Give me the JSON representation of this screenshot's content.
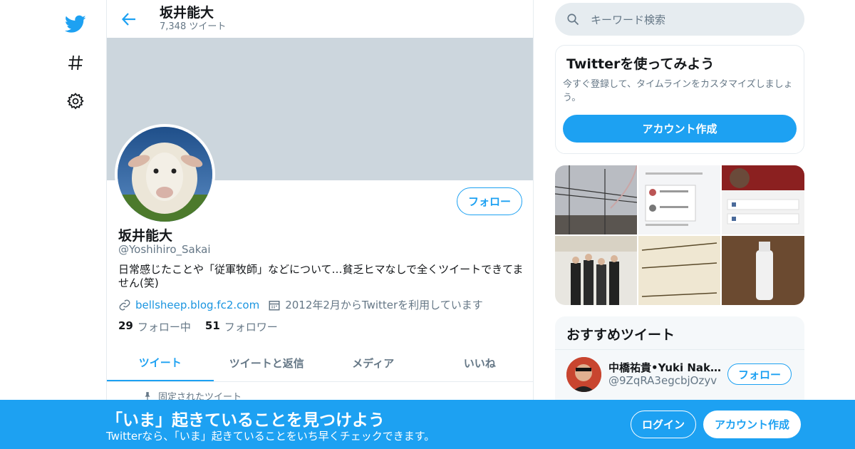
{
  "colors": {
    "accent": "#1da1f2",
    "banner": "#ccd6dd",
    "muted": "#657786"
  },
  "nav": {
    "icons": [
      "twitter-logo-icon",
      "hashtag-icon",
      "gear-icon"
    ]
  },
  "header": {
    "name": "坂井能大",
    "tweet_count": "7,348 ツイート"
  },
  "profile": {
    "name": "坂井能大",
    "handle": "@Yoshihiro_Sakai",
    "bio": "日常感じたことや「従軍牧師」などについて…貧乏ヒマなしで全くツイートできてません(笑)",
    "website": "bellsheep.blog.fc2.com",
    "joined": "2012年2月からTwitterを利用しています",
    "following_count": "29",
    "following_label": "フォロー中",
    "followers_count": "51",
    "followers_label": "フォロワー",
    "follow_button": "フォロー"
  },
  "tabs": [
    "ツイート",
    "ツイートと返信",
    "メディア",
    "いいね"
  ],
  "pinned_label": "固定されたツイート",
  "search": {
    "placeholder": "キーワード検索"
  },
  "signup_box": {
    "title": "Twitterを使ってみよう",
    "desc": "今すぐ登録して、タイムラインをカスタマイズしましょう。",
    "button": "アカウント作成"
  },
  "recommended": {
    "title": "おすすめツイート",
    "user_name": "中橋祐貴•Yuki Nakahashi",
    "user_handle": "@9ZqRA3egcbjOzyv",
    "follow_button": "フォロー"
  },
  "bottom_bar": {
    "title": "「いま」起きていることを見つけよう",
    "subtitle": "Twitterなら、「いま」起きていることをいち早くチェックできます。",
    "login": "ログイン",
    "signup": "アカウント作成"
  }
}
